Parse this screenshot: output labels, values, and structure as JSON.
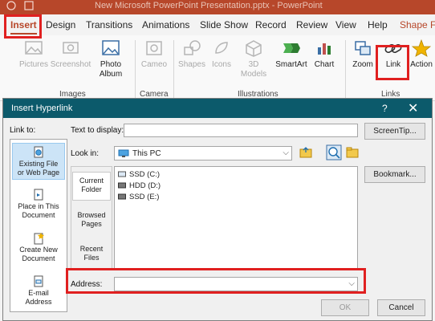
{
  "titlebar": {
    "text": "New Microsoft PowerPoint Presentation.pptx - PowerPoint"
  },
  "tabs": [
    "Insert",
    "Design",
    "Transitions",
    "Animations",
    "Slide Show",
    "Record",
    "Review",
    "View",
    "Help",
    "Shape Fo"
  ],
  "ribbon": {
    "buttons": {
      "pictures": "Pictures",
      "screenshot": "Screenshot",
      "photo_album_1": "Photo",
      "photo_album_2": "Album",
      "cameo": "Cameo",
      "shapes": "Shapes",
      "icons": "Icons",
      "models_1": "3D",
      "models_2": "Models",
      "smartart": "SmartArt",
      "chart": "Chart",
      "zoom": "Zoom",
      "link": "Link",
      "action": "Action"
    },
    "groups": {
      "images": "Images",
      "camera": "Camera",
      "illustrations": "Illustrations",
      "links": "Links"
    }
  },
  "dialog": {
    "title": "Insert Hyperlink",
    "help": "?",
    "close": "✕",
    "link_to_label": "Link to:",
    "text_to_display_label": "Text to display:",
    "text_to_display_value": "",
    "screentip_button": "ScreenTip...",
    "look_in_label": "Look in:",
    "look_in_value": "This PC",
    "bookmark_button": "Bookmark...",
    "link_to": [
      {
        "label_1": "Existing File",
        "label_2": "or Web Page"
      },
      {
        "label_1": "Place in This",
        "label_2": "Document"
      },
      {
        "label_1": "Create New",
        "label_2": "Document"
      },
      {
        "label_1": "E-mail",
        "label_2": "Address"
      }
    ],
    "nav": [
      {
        "label_1": "Current",
        "label_2": "Folder"
      },
      {
        "label_1": "Browsed",
        "label_2": "Pages"
      },
      {
        "label_1": "Recent",
        "label_2": "Files"
      }
    ],
    "files": [
      "SSD (C:)",
      "HDD (D:)",
      "SSD (E:)"
    ],
    "address_label": "Address:",
    "address_value": "",
    "ok_button": "OK",
    "cancel_button": "Cancel"
  },
  "colors": {
    "accent": "#b7472a",
    "dialog_title": "#0c5a6b",
    "highlight": "#e02020",
    "selection": "#cce4f7"
  }
}
